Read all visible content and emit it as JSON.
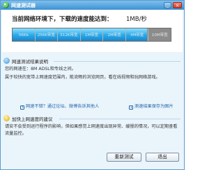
{
  "window": {
    "title": "网速测试器",
    "close_symbol": "×",
    "minimize_symbol": "_"
  },
  "speed": {
    "title": "当前网络环境下，下载的速度能达到：",
    "value": "1MB/秒",
    "fill_fraction": 0.85,
    "scale": [
      "56Kb",
      "256K带宽",
      "512K带宽",
      "1M带宽",
      "2M带宽",
      "4M带宽",
      "10M带宽"
    ]
  },
  "results": {
    "section1_title": "网速测试结果说明",
    "line1": "您的网速在：8M ADSL和专线之间。",
    "line2": "属于较快的宽带上网速度范围内，能流畅的浏览网页，看在线视频和玩网络游戏。",
    "link_share": "网速不错？通过论坛、微博告诉其他人",
    "link_save": "测速结果保存为图片",
    "section2_title": "加快上网速度的建议",
    "advice": "请安不会受到运行程序的影响，但如果感觉上网速度出现异常、缓慢的情况，可以定期查看流量监控。",
    "retest_button": "重新测试",
    "exit_button": "退出"
  },
  "colors": {
    "meter_fill": "#28a8ea",
    "link": "#2266aa",
    "titlebar": "#3e91d2"
  },
  "icons": {
    "app": "globe-icon",
    "info": "info-icon",
    "tip": "bulb-icon",
    "share": "share-icon",
    "save": "save-icon"
  }
}
